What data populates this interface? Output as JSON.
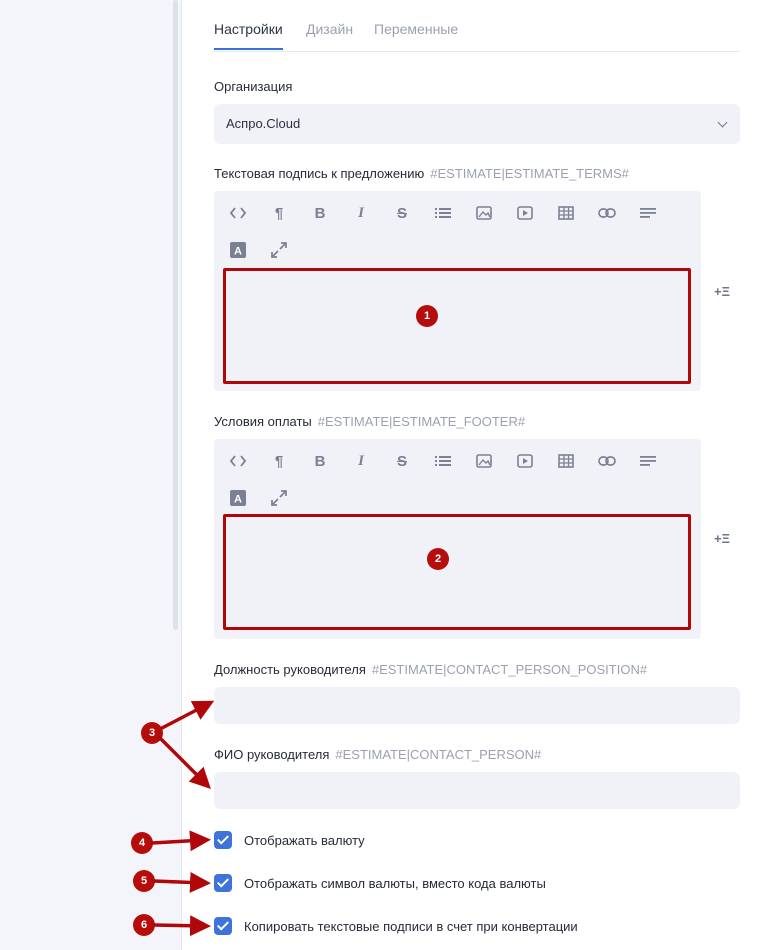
{
  "tabs": [
    {
      "label": "Настройки",
      "active": true
    },
    {
      "label": "Дизайн",
      "active": false
    },
    {
      "label": "Переменные",
      "active": false
    }
  ],
  "organization": {
    "label": "Организация",
    "value": "Аспро.Cloud"
  },
  "terms": {
    "label": "Текстовая подпись к предложению",
    "variable": "#ESTIMATE|ESTIMATE_TERMS#",
    "marker": "1"
  },
  "footer": {
    "label": "Условия оплаты",
    "variable": "#ESTIMATE|ESTIMATE_FOOTER#",
    "marker": "2"
  },
  "position": {
    "label": "Должность руководителя",
    "variable": "#ESTIMATE|CONTACT_PERSON_POSITION#",
    "value": ""
  },
  "person": {
    "label": "ФИО руководителя",
    "variable": "#ESTIMATE|CONTACT_PERSON#",
    "value": ""
  },
  "side_button": "+Ξ",
  "toolbar_icons": [
    "code-icon",
    "paragraph-icon",
    "bold-icon",
    "italic-icon",
    "strikethrough-icon",
    "list-icon",
    "image-icon",
    "video-icon",
    "table-icon",
    "link-icon",
    "align-icon",
    "text-color-icon",
    "fullscreen-icon"
  ],
  "checkboxes": [
    {
      "label": "Отображать валюту",
      "checked": true,
      "marker": "4"
    },
    {
      "label": "Отображать символ валюты, вместо кода валюты",
      "checked": true,
      "marker": "5"
    },
    {
      "label": "Копировать текстовые подписи в счет при конвертации",
      "checked": true,
      "marker": "6"
    }
  ],
  "marker_inputs": "3",
  "colors": {
    "accent": "#3e73dc",
    "annotation": "#b0080a",
    "field_bg": "#f1f2f7"
  }
}
